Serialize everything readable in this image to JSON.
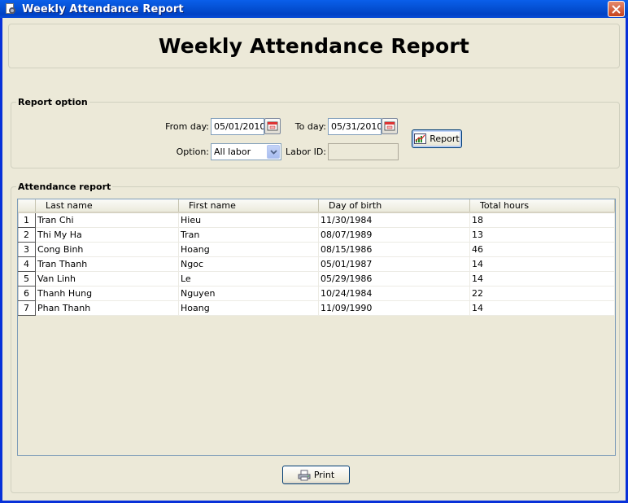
{
  "window": {
    "title": "Weekly Attendance Report",
    "close_icon": "close-icon"
  },
  "header": {
    "title": "Weekly Attendance Report"
  },
  "report_option": {
    "group_title": "Report option",
    "from_day_label": "From day:",
    "from_day_value": "05/01/2010",
    "to_day_label": "To day:",
    "to_day_value": "05/31/2010",
    "option_label": "Option:",
    "option_value": "All labor",
    "labor_id_label": "Labor ID:",
    "labor_id_value": "",
    "report_button": "Report"
  },
  "attendance": {
    "group_title": "Attendance report",
    "columns": [
      "Last name",
      "First name",
      "Day of birth",
      "Total hours"
    ],
    "rows": [
      {
        "num": "1",
        "last": "Tran Chi",
        "first": "Hieu",
        "dob": "11/30/1984",
        "hours": "18"
      },
      {
        "num": "2",
        "last": "Thi My Ha",
        "first": "Tran",
        "dob": "08/07/1989",
        "hours": "13"
      },
      {
        "num": "3",
        "last": "Cong Binh",
        "first": "Hoang",
        "dob": "08/15/1986",
        "hours": "46"
      },
      {
        "num": "4",
        "last": "Tran Thanh",
        "first": "Ngoc",
        "dob": "05/01/1987",
        "hours": "14"
      },
      {
        "num": "5",
        "last": "Van Linh",
        "first": "Le",
        "dob": "05/29/1986",
        "hours": "14"
      },
      {
        "num": "6",
        "last": "Thanh Hung",
        "first": "Nguyen",
        "dob": "10/24/1984",
        "hours": "22"
      },
      {
        "num": "7",
        "last": "Phan Thanh",
        "first": "Hoang",
        "dob": "11/09/1990",
        "hours": "14"
      }
    ]
  },
  "footer": {
    "print_button": "Print"
  },
  "colors": {
    "titlebar": "#0a5fea",
    "window_bg": "#ece9d8",
    "close_button": "#c6421c"
  }
}
